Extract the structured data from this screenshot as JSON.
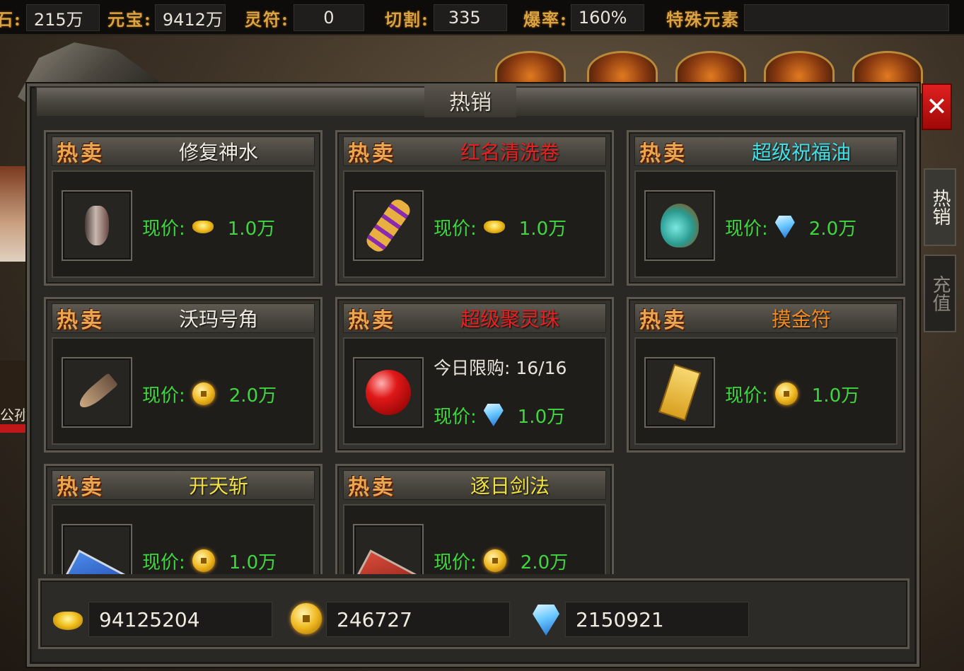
{
  "topbar": {
    "stats": [
      {
        "label": "石:",
        "value": "215万"
      },
      {
        "label": "元宝:",
        "value": "9412万"
      },
      {
        "label": "灵符:",
        "value": "0"
      },
      {
        "label": "切割:",
        "value": "335"
      },
      {
        "label": "爆率:",
        "value": "160%"
      },
      {
        "label": "特殊元素",
        "value": ""
      }
    ]
  },
  "scene": {
    "left_player_name": "公孙"
  },
  "panel": {
    "title": "热销",
    "close_label": "✕",
    "side_tabs": [
      {
        "label": "热销",
        "active": true
      },
      {
        "label": "充值",
        "active": false
      }
    ]
  },
  "hot_label": "热卖",
  "price_label": "现价:",
  "items": [
    {
      "name": "修复神水",
      "name_color": "#f0ece2",
      "icon": "potion-bottle-icon",
      "currency": "ingot",
      "price": "1.0万"
    },
    {
      "name": "红名清洗卷",
      "name_color": "#e82020",
      "icon": "scroll-icon",
      "currency": "ingot",
      "price": "1.0万"
    },
    {
      "name": "超级祝福油",
      "name_color": "#40e0e8",
      "icon": "blessing-oil-icon",
      "currency": "diamond",
      "price": "2.0万"
    },
    {
      "name": "沃玛号角",
      "name_color": "#f0ece2",
      "icon": "horn-icon",
      "currency": "coin",
      "price": "2.0万"
    },
    {
      "name": "超级聚灵珠",
      "name_color": "#e82020",
      "icon": "spirit-pearl-icon",
      "currency": "diamond",
      "price": "1.0万",
      "limit": "今日限购: 16/16"
    },
    {
      "name": "摸金符",
      "name_color": "#f08a20",
      "icon": "talisman-icon",
      "currency": "coin",
      "price": "1.0万"
    },
    {
      "name": "开天斩",
      "name_color": "#f0e040",
      "icon": "skill-book-blue-icon",
      "currency": "coin",
      "price": "1.0万"
    },
    {
      "name": "逐日剑法",
      "name_color": "#f0e040",
      "icon": "skill-book-red-icon",
      "currency": "coin",
      "price": "2.0万"
    }
  ],
  "currencies": [
    {
      "icon": "gold-ingot-icon",
      "value": "94125204"
    },
    {
      "icon": "gold-coin-icon",
      "value": "246727"
    },
    {
      "icon": "diamond-icon",
      "value": "2150921"
    }
  ],
  "colors": {
    "price_green": "#3fd63f",
    "hot_label_orange": "#e8a650",
    "close_red": "#e02020"
  }
}
